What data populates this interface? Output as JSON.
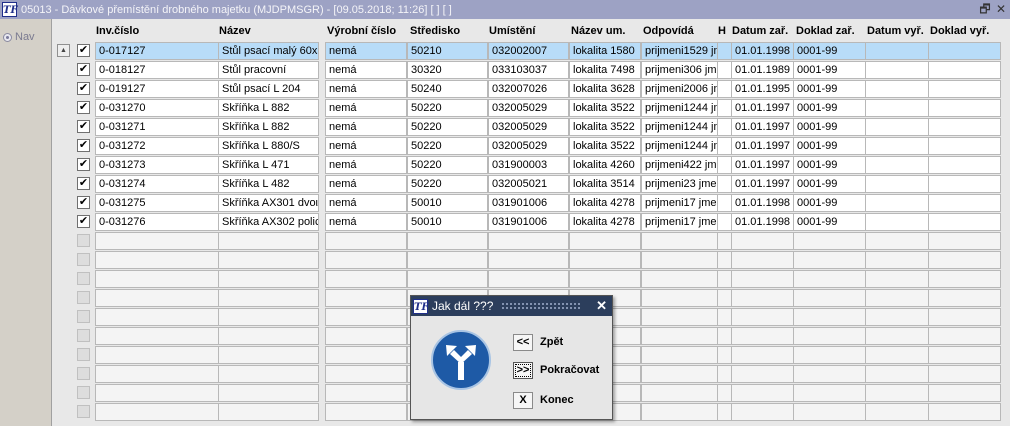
{
  "window": {
    "title": "05013 - Dávkové přemístění drobného majetku (MJDPMSGR) - [09.05.2018; 11:26]  [ ]  [ ]",
    "app_icon": "TF",
    "restore_glyph": "🗗",
    "close_glyph": "✕"
  },
  "nav": {
    "label": "Nav"
  },
  "grid": {
    "columns": [
      "Inv.číslo",
      "Název",
      "Výrobní číslo",
      "Středisko",
      "Umístění",
      "Název um.",
      "Odpovídá",
      "H",
      "Datum zař.",
      "Doklad zař.",
      "Datum vyř.",
      "Doklad vyř."
    ],
    "rows": [
      [
        "0-017127",
        "Stůl psací malý 60x",
        "nemá",
        "50210",
        "032002007",
        "lokalita 1580",
        "prijmeni1529 jm",
        "",
        "01.01.1998",
        "0001-99",
        "",
        ""
      ],
      [
        "0-018127",
        "Stůl pracovní",
        "nemá",
        "30320",
        "033103037",
        "lokalita 7498",
        "prijmeni306 jme",
        "",
        "01.01.1989",
        "0001-99",
        "",
        ""
      ],
      [
        "0-019127",
        "Stůl psací L 204",
        "nemá",
        "50240",
        "032007026",
        "lokalita 3628",
        "prijmeni2006 jn",
        "",
        "01.01.1995",
        "0001-99",
        "",
        ""
      ],
      [
        "0-031270",
        "Skříňka L 882",
        "nemá",
        "50220",
        "032005029",
        "lokalita 3522",
        "prijmeni1244 jm",
        "",
        "01.01.1997",
        "0001-99",
        "",
        ""
      ],
      [
        "0-031271",
        "Skříňka L 882",
        "nemá",
        "50220",
        "032005029",
        "lokalita 3522",
        "prijmeni1244 jm",
        "",
        "01.01.1997",
        "0001-99",
        "",
        ""
      ],
      [
        "0-031272",
        "Skříňka L 880/S",
        "nemá",
        "50220",
        "032005029",
        "lokalita 3522",
        "prijmeni1244 jm",
        "",
        "01.01.1997",
        "0001-99",
        "",
        ""
      ],
      [
        "0-031273",
        "Skříňka L 471",
        "nemá",
        "50220",
        "031900003",
        "lokalita 4260",
        "prijmeni422 jme",
        "",
        "01.01.1997",
        "0001-99",
        "",
        ""
      ],
      [
        "0-031274",
        "Skříňka L 482",
        "nemá",
        "50220",
        "032005021",
        "lokalita 3514",
        "prijmeni23 jmen",
        "",
        "01.01.1997",
        "0001-99",
        "",
        ""
      ],
      [
        "0-031275",
        "Skříňka AX301 dvoι",
        "nemá",
        "50010",
        "031901006",
        "lokalita 4278",
        "prijmeni17 jmen",
        "",
        "01.01.1998",
        "0001-99",
        "",
        ""
      ],
      [
        "0-031276",
        "Skříňka AX302 polic",
        "nemá",
        "50010",
        "031901006",
        "lokalita 4278",
        "prijmeni17 jmen",
        "",
        "01.01.1998",
        "0001-99",
        "",
        ""
      ]
    ],
    "checked_glyph": "✔",
    "scroll_up_glyph": "▲"
  },
  "dialog": {
    "title": "Jak dál ???",
    "close_glyph": "✕",
    "buttons": [
      {
        "glyph": "<<",
        "label": "Zpět"
      },
      {
        "glyph": ">>",
        "label": "Pokračovat"
      },
      {
        "glyph": "X",
        "label": "Konec"
      }
    ]
  },
  "colors": {
    "title_bar": "#9da2c4",
    "selected_row": "#b8dcf8",
    "dialog_title": "#2c3e5c",
    "sign_blue": "#1e5aa6"
  }
}
